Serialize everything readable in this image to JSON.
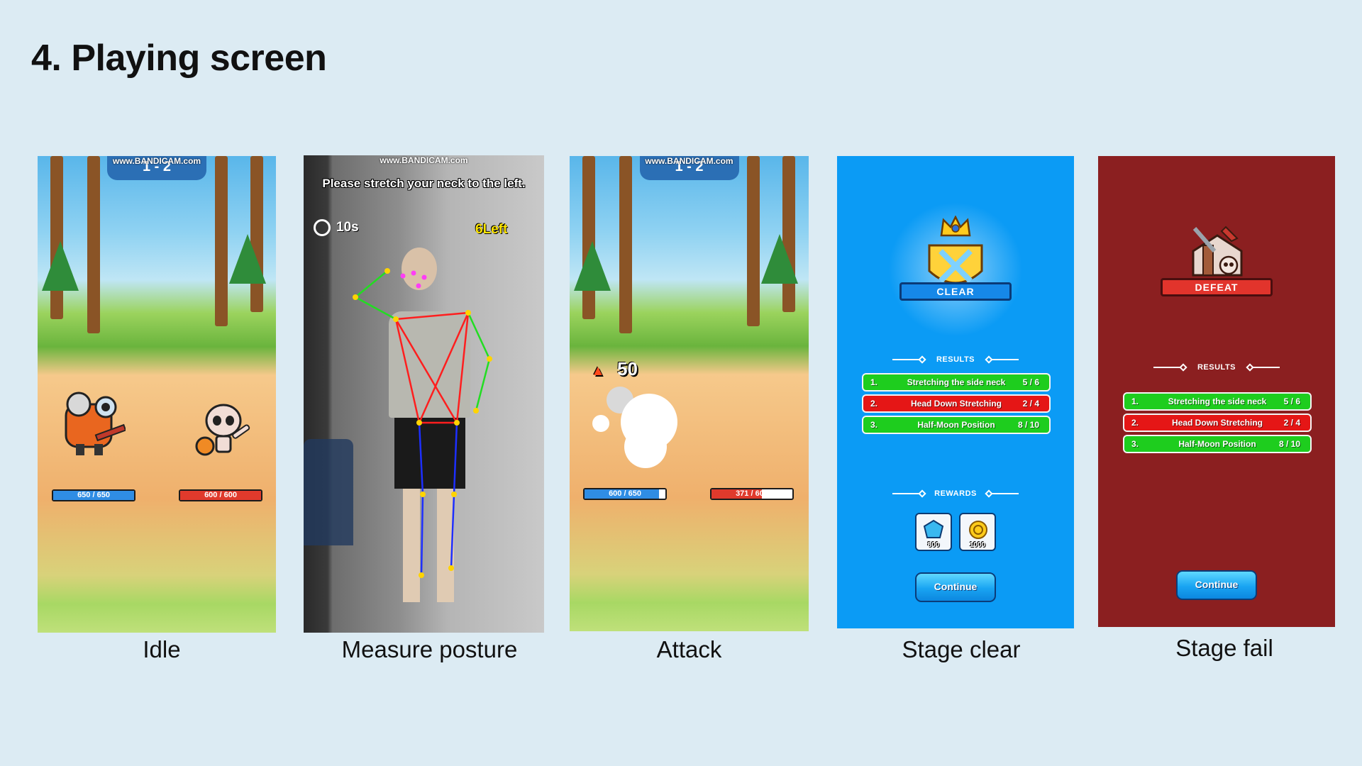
{
  "slide": {
    "title": "4. Playing screen"
  },
  "colors": {
    "background": "#dcebf3",
    "clear_panel": "#0b9bf5",
    "fail_panel": "#8b1f20",
    "row_green": "#1ecd1e",
    "row_red": "#e51616"
  },
  "idle": {
    "caption": "Idle",
    "watermark": "www.BANDICAM.com",
    "stage": "1 - 2",
    "player_hp": "650 / 650",
    "player_hp_ratio": 1.0,
    "enemy_hp": "600 / 600",
    "enemy_hp_ratio": 1.0
  },
  "posture": {
    "caption": "Measure posture",
    "watermark": "www.BANDICAM.com",
    "instruction": "Please stretch your neck to the left.",
    "timer": "10s",
    "remaining": "6Left",
    "icons": {
      "timer": "clock-icon"
    }
  },
  "attack": {
    "caption": "Attack",
    "watermark": "www.BANDICAM.com",
    "stage": "1 - 2",
    "damage": "50",
    "player_hp": "600 / 650",
    "player_hp_ratio": 0.92,
    "enemy_hp": "371 / 600",
    "enemy_hp_ratio": 0.62,
    "icons": {
      "damage": "fire-icon"
    }
  },
  "clear": {
    "caption": "Stage clear",
    "badge": "CLEAR",
    "results_label": "RESULTS",
    "results": [
      {
        "num": "1.",
        "name": "Stretching the side neck",
        "score": "5 / 6",
        "status": "pass"
      },
      {
        "num": "2.",
        "name": "Head Down Stretching",
        "score": "2 / 4",
        "status": "fail"
      },
      {
        "num": "3.",
        "name": "Half-Moon Position",
        "score": "8 / 10",
        "status": "pass"
      }
    ],
    "rewards_label": "REWARDS",
    "rewards": [
      {
        "icon": "gem-icon",
        "amount": "800"
      },
      {
        "icon": "coin-icon",
        "amount": "1000"
      }
    ],
    "continue": "Continue"
  },
  "fail": {
    "caption": "Stage fail",
    "badge": "DEFEAT",
    "results_label": "RESULTS",
    "results": [
      {
        "num": "1.",
        "name": "Stretching the side neck",
        "score": "5 / 6",
        "status": "pass"
      },
      {
        "num": "2.",
        "name": "Head Down Stretching",
        "score": "2 / 4",
        "status": "fail"
      },
      {
        "num": "3.",
        "name": "Half-Moon Position",
        "score": "8 / 10",
        "status": "pass"
      }
    ],
    "continue": "Continue"
  }
}
